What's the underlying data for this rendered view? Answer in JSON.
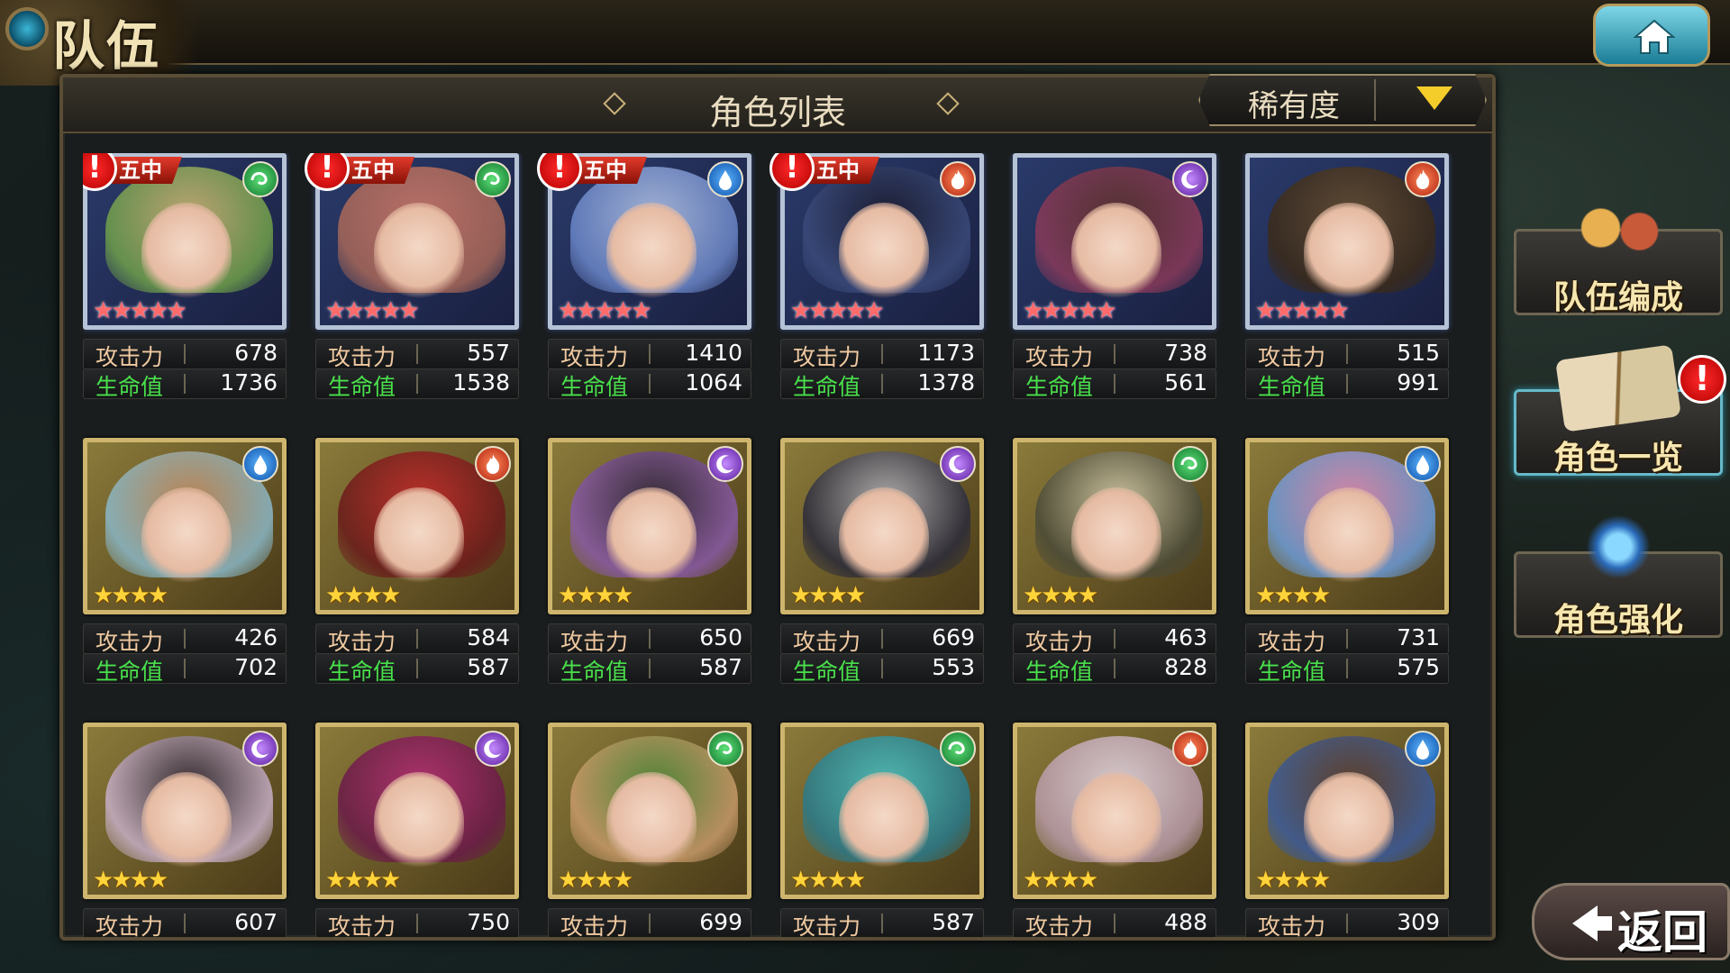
{
  "screen": {
    "title": "队伍"
  },
  "panel": {
    "title": "角色列表",
    "sort": {
      "label": "稀有度"
    }
  },
  "labels": {
    "atk": "攻击力",
    "hp": "生命值",
    "team_tag": "五中",
    "alert": "!"
  },
  "sidebar": {
    "buttons": [
      {
        "label": "队伍编成",
        "active": false
      },
      {
        "label": "角色一览",
        "active": true
      },
      {
        "label": "角色强化",
        "active": false
      }
    ]
  },
  "back": {
    "label": "返回"
  },
  "element_colors": {
    "wind": "#1fae42",
    "water": "#1e76d6",
    "fire": "#d83a1e",
    "dark": "#8a3ad0"
  },
  "characters": [
    {
      "rarity": 5,
      "element": "wind",
      "in_team": true,
      "atk": "678",
      "hp": "1736",
      "palette": [
        "#d8b878",
        "#6fa04a"
      ]
    },
    {
      "rarity": 5,
      "element": "wind",
      "in_team": true,
      "atk": "557",
      "hp": "1538",
      "palette": [
        "#d27a6a",
        "#a86858"
      ]
    },
    {
      "rarity": 5,
      "element": "water",
      "in_team": true,
      "atk": "1410",
      "hp": "1064",
      "palette": [
        "#b8c8e8",
        "#6a86c8"
      ]
    },
    {
      "rarity": 5,
      "element": "fire",
      "in_team": true,
      "atk": "1173",
      "hp": "1378",
      "palette": [
        "#1a1a2a",
        "#3a4a7a"
      ]
    },
    {
      "rarity": 5,
      "element": "dark",
      "in_team": false,
      "atk": "738",
      "hp": "561",
      "palette": [
        "#5a3228",
        "#8a3a5a"
      ]
    },
    {
      "rarity": 5,
      "element": "fire",
      "in_team": false,
      "atk": "515",
      "hp": "991",
      "palette": [
        "#6a5030",
        "#3a2a18"
      ]
    },
    {
      "rarity": 4,
      "element": "water",
      "in_team": false,
      "atk": "426",
      "hp": "702",
      "palette": [
        "#c88a5a",
        "#8ab8c8"
      ]
    },
    {
      "rarity": 4,
      "element": "fire",
      "in_team": false,
      "atk": "584",
      "hp": "587",
      "palette": [
        "#c8282a",
        "#6a1a1a"
      ]
    },
    {
      "rarity": 4,
      "element": "dark",
      "in_team": false,
      "atk": "650",
      "hp": "587",
      "palette": [
        "#2a2238",
        "#8a5aa8"
      ]
    },
    {
      "rarity": 4,
      "element": "dark",
      "in_team": false,
      "atk": "669",
      "hp": "553",
      "palette": [
        "#b8b8c0",
        "#2a2a3a"
      ]
    },
    {
      "rarity": 4,
      "element": "wind",
      "in_team": false,
      "atk": "463",
      "hp": "828",
      "palette": [
        "#d8d0b0",
        "#4a4a38"
      ]
    },
    {
      "rarity": 4,
      "element": "water",
      "in_team": false,
      "atk": "731",
      "hp": "575",
      "palette": [
        "#e88ab8",
        "#6a9ad8"
      ]
    },
    {
      "rarity": 4,
      "element": "dark",
      "in_team": false,
      "atk": "607",
      "hp": "",
      "palette": [
        "#2a2230",
        "#c8b0c8"
      ]
    },
    {
      "rarity": 4,
      "element": "dark",
      "in_team": false,
      "atk": "750",
      "hp": "",
      "palette": [
        "#b82a78",
        "#6a1a48"
      ]
    },
    {
      "rarity": 4,
      "element": "wind",
      "in_team": false,
      "atk": "699",
      "hp": "",
      "palette": [
        "#4a8a3a",
        "#c89a6a"
      ]
    },
    {
      "rarity": 4,
      "element": "wind",
      "in_team": false,
      "atk": "587",
      "hp": "",
      "palette": [
        "#4ac8c8",
        "#2a7a8a"
      ]
    },
    {
      "rarity": 4,
      "element": "fire",
      "in_team": false,
      "atk": "488",
      "hp": "",
      "palette": [
        "#e8dce8",
        "#b89aa8"
      ]
    },
    {
      "rarity": 4,
      "element": "water",
      "in_team": false,
      "atk": "309",
      "hp": "",
      "palette": [
        "#5a3a2a",
        "#3a5a9a"
      ]
    }
  ]
}
